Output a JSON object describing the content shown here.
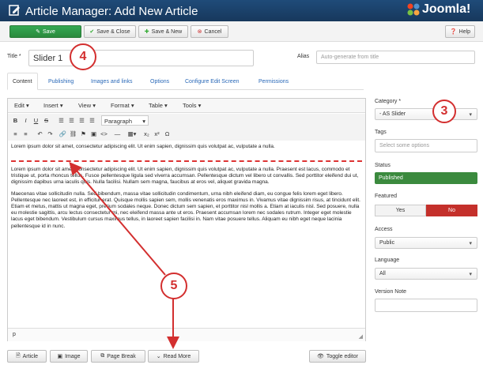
{
  "header": {
    "title": "Article Manager: Add New Article",
    "logo_text": "Joomla!"
  },
  "toolbar": {
    "save": "Save",
    "save_close": "Save & Close",
    "save_new": "Save & New",
    "cancel": "Cancel",
    "help": "Help"
  },
  "form": {
    "title_label": "Title *",
    "title_value": "Slider 1",
    "alias_label": "Alias",
    "alias_placeholder": "Auto-generate from title"
  },
  "tabs": [
    "Content",
    "Publishing",
    "Images and links",
    "Options",
    "Configure Edit Screen",
    "Permissions"
  ],
  "editor": {
    "menus": [
      "Edit",
      "Insert",
      "View",
      "Format",
      "Table",
      "Tools"
    ],
    "paragraph_format": "Paragraph",
    "status_path": "p",
    "para1": "Lorem ipsum dolor sit amet, consectetur adipiscing elit. Ut enim sapien, dignissim quis volutpat ac, vulputate a nulla.",
    "para2": "Lorem ipsum dolor sit amet, consectetur adipiscing elit. Ut enim sapien, dignissim quis volutpat ac, vulputate a nulla. Praesent est lacus, commodo et tristique ut, porta rhoncus tellus. Fusce pellentesque ligula sed viverra accumsan. Pellentesque dictum vel libero ut convallis. Sed porttitor eleifend dui ut, dignissim dapibus urna iaculis quis. Nulla facilisi. Nullam sem magna, faucibus at eros vel, aliquet gravida magna.",
    "para3": "Maecenas vitae sollicitudin nulla. Sed bibendum, massa vitae sollicitudin condimentum, urna nibh eleifend diam, eu congue felis lorem eget libero. Pellentesque nec laoreet est, in efficitur erat. Quisque mollis sapien sem, mollis venenatis eros maximus in. Vivamus vitae dignissim risus, at tincidunt elit. Etiam et metus, mattis ut magna eget, pretium sodales neque. Donec dictum sem sapien, et porttitor nisl mollis a. Etiam at iaculis nisl. Sed posuere, nulla eu molestie sagittis, arcu lectus consectetur mi, nec eleifend massa ante ut eros. Praesent accumsan lorem nec sodales rutrum. Integer eget molestie lacus eget bibendum. Vestibulum cursus maximus tellus, in laoreet sapien facilisi in. Nam vitae posuere tellus. Aliquam eu nibh eget neque lacinia pellentesque id in nunc."
  },
  "buttons_bottom": {
    "article": "Article",
    "image": "Image",
    "page_break": "Page Break",
    "read_more": "Read More",
    "toggle_editor": "Toggle editor"
  },
  "sidebar": {
    "category_label": "Category *",
    "category_value": "- AS Slider",
    "tags_label": "Tags",
    "tags_placeholder": "Select some options",
    "status_label": "Status",
    "status_value": "Published",
    "featured_label": "Featured",
    "featured_yes": "Yes",
    "featured_no": "No",
    "access_label": "Access",
    "access_value": "Public",
    "language_label": "Language",
    "language_value": "All",
    "version_note_label": "Version Note",
    "version_note_value": ""
  },
  "callouts": {
    "c3": "3",
    "c4": "4",
    "c5": "5"
  },
  "colors": {
    "header": "#1f4b79",
    "save_green": "#2f9a47",
    "published_green": "#3b8a3e",
    "featured_no_red": "#c4302b",
    "callout_red": "#d32f2f"
  }
}
